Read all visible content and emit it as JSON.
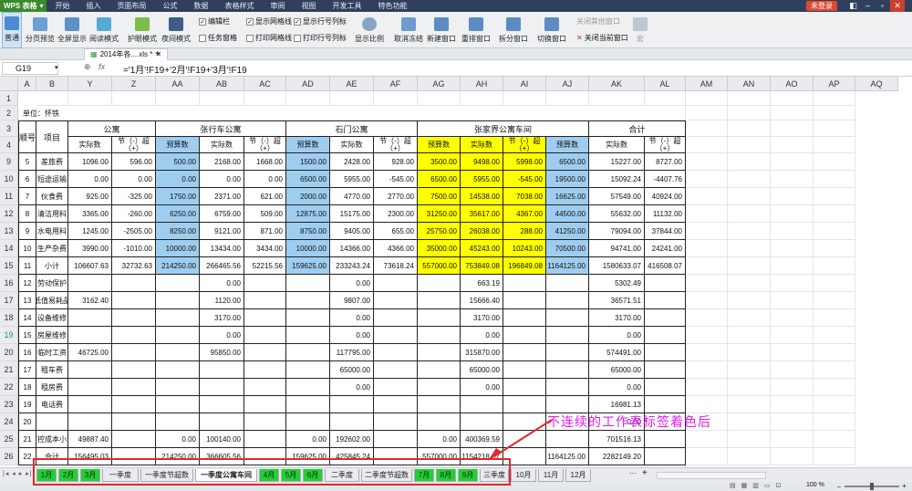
{
  "app": {
    "name": "WPS 表格",
    "login": "未登录"
  },
  "menu": [
    "开始",
    "插入",
    "页面布局",
    "公式",
    "数据",
    "表格样式",
    "审阅",
    "视图",
    "开发工具",
    "特色功能"
  ],
  "toolbar": {
    "normal": "普通",
    "page_break": "分页预览",
    "fullscreen": "全屏显示",
    "reading": "阅读模式",
    "eye_care": "护眼模式",
    "night": "夜间模式",
    "edit_bar": "编辑栏",
    "task_pane": "任务窗格",
    "show_grid": "显示网格线",
    "print_grid": "打印网格线",
    "show_headers": "显示行号列标",
    "print_headers": "打印行号列标",
    "zoom": "显示比例",
    "unfreeze": "取消冻结",
    "new_window": "新建窗口",
    "arrange": "重排窗口",
    "split": "拆分窗口",
    "switch": "切换窗口",
    "close_others": "关闭其他窗口",
    "close_current": "关闭当前窗口",
    "macro": "宏"
  },
  "doc_tab": "2014年各....xls *",
  "formula": {
    "cell_ref": "G19",
    "fx": "fx",
    "content": "='1月'!F19+'2月'!F19+'3月'!F19"
  },
  "col_letters": [
    "A",
    "B",
    "Y",
    "Z",
    "AA",
    "AB",
    "AC",
    "AD",
    "AE",
    "AF",
    "AG",
    "AH",
    "AI",
    "AJ",
    "AK",
    "AL",
    "AM",
    "AN",
    "AO",
    "AP",
    "AQ"
  ],
  "row_numbers": [
    "1",
    "2",
    "3",
    "4",
    "9",
    "10",
    "11",
    "12",
    "13",
    "14",
    "15",
    "16",
    "17",
    "18",
    "19",
    "20",
    "21",
    "22",
    "23",
    "24",
    "25",
    "26"
  ],
  "header": {
    "unit": "单位：怀铁",
    "seq": "顺号",
    "item": "项目",
    "groups": [
      "公寓",
      "张行车公寓",
      "石门公寓",
      "张家界公寓车间",
      "合计"
    ],
    "actual": "实际数",
    "budget": "预算数",
    "diff": "节（-）超（+）"
  },
  "rows": [
    {
      "n": "5",
      "name": "差旅费",
      "y": "1096.00",
      "z": "596.00",
      "aa": "500.00",
      "ab": "2168.00",
      "ac": "1668.00",
      "ad": "1500.00",
      "ae": "2428.00",
      "af": "928.00",
      "ag": "3500.00",
      "ah": "9498.00",
      "ai": "5998.00",
      "aj": "6500.00",
      "ak": "15227.00",
      "al": "8727.00"
    },
    {
      "n": "6",
      "name": "短途运输",
      "y": "0.00",
      "z": "0.00",
      "aa": "0.00",
      "ab": "0.00",
      "ac": "0.00",
      "ad": "6500.00",
      "ae": "5955.00",
      "af": "-545.00",
      "ag": "6500.00",
      "ah": "5955.00",
      "ai": "-545.00",
      "aj": "19500.00",
      "ak": "15092.24",
      "al": "-4407.76"
    },
    {
      "n": "7",
      "name": "伙食费",
      "y": "925.00",
      "z": "-325.00",
      "aa": "1750.00",
      "ab": "2371.00",
      "ac": "621.00",
      "ad": "2000.00",
      "ae": "4770.00",
      "af": "2770.00",
      "ag": "7500.00",
      "ah": "14538.00",
      "ai": "7038.00",
      "aj": "16625.00",
      "ak": "57549.00",
      "al": "40924.00"
    },
    {
      "n": "8",
      "name": "清洁用料",
      "y": "3365.00",
      "z": "-260.00",
      "aa": "6250.00",
      "ab": "6759.00",
      "ac": "509.00",
      "ad": "12875.00",
      "ae": "15175.00",
      "af": "2300.00",
      "ag": "31250.00",
      "ah": "35617.00",
      "ai": "4367.00",
      "aj": "44500.00",
      "ak": "55632.00",
      "al": "11132.00"
    },
    {
      "n": "9",
      "name": "水电用料",
      "y": "1245.00",
      "z": "-2505.00",
      "aa": "8250.00",
      "ab": "9121.00",
      "ac": "871.00",
      "ad": "8750.00",
      "ae": "9405.00",
      "af": "655.00",
      "ag": "25750.00",
      "ah": "26038.00",
      "ai": "288.00",
      "aj": "41250.00",
      "ak": "79094.00",
      "al": "37844.00"
    },
    {
      "n": "10",
      "name": "生产杂费",
      "y": "3990.00",
      "z": "-1010.00",
      "aa": "10000.00",
      "ab": "13434.00",
      "ac": "3434.00",
      "ad": "10000.00",
      "ae": "14366.00",
      "af": "4366.00",
      "ag": "35000.00",
      "ah": "45243.00",
      "ai": "10243.00",
      "aj": "70500.00",
      "ak": "94741.00",
      "al": "24241.00"
    },
    {
      "n": "11",
      "name": "小计",
      "y": "106607.63",
      "z": "32732.63",
      "aa": "214250.00",
      "ab": "266465.56",
      "ac": "52215.56",
      "ad": "159625.00",
      "ae": "233243.24",
      "af": "73618.24",
      "ag": "557000.00",
      "ah": "753849.08",
      "ai": "196849.08",
      "aj": "1164125.00",
      "ak": "1580633.07",
      "al": "416508.07"
    },
    {
      "n": "12",
      "name": "劳动保护",
      "y": "",
      "z": "",
      "aa": "",
      "ab": "0.00",
      "ac": "",
      "ad": "",
      "ae": "0.00",
      "af": "",
      "ag": "",
      "ah": "663.19",
      "ai": "",
      "aj": "",
      "ak": "5302.49",
      "al": ""
    },
    {
      "n": "13",
      "name": "低值易耗品",
      "y": "3162.40",
      "z": "",
      "aa": "",
      "ab": "1120.00",
      "ac": "",
      "ad": "",
      "ae": "9807.00",
      "af": "",
      "ag": "",
      "ah": "15666.40",
      "ai": "",
      "aj": "",
      "ak": "36571.51",
      "al": ""
    },
    {
      "n": "14",
      "name": "设备维修",
      "y": "",
      "z": "",
      "aa": "",
      "ab": "3170.00",
      "ac": "",
      "ad": "",
      "ae": "0.00",
      "af": "",
      "ag": "",
      "ah": "3170.00",
      "ai": "",
      "aj": "",
      "ak": "3170.00",
      "al": ""
    },
    {
      "n": "15",
      "name": "房屋维修",
      "y": "",
      "z": "",
      "aa": "",
      "ab": "0.00",
      "ac": "",
      "ad": "",
      "ae": "0.00",
      "af": "",
      "ag": "",
      "ah": "0.00",
      "ai": "",
      "aj": "",
      "ak": "0.00",
      "al": ""
    },
    {
      "n": "16",
      "name": "临时工资",
      "y": "46725.00",
      "z": "",
      "aa": "",
      "ab": "95850.00",
      "ac": "",
      "ad": "",
      "ae": "117795.00",
      "af": "",
      "ag": "",
      "ah": "315870.00",
      "ai": "",
      "aj": "",
      "ak": "574491.00",
      "al": ""
    },
    {
      "n": "17",
      "name": "租车费",
      "y": "",
      "z": "",
      "aa": "",
      "ab": "",
      "ac": "",
      "ad": "",
      "ae": "65000.00",
      "af": "",
      "ag": "",
      "ah": "65000.00",
      "ai": "",
      "aj": "",
      "ak": "65000.00",
      "al": ""
    },
    {
      "n": "18",
      "name": "租房费",
      "y": "",
      "z": "",
      "aa": "",
      "ab": "",
      "ac": "",
      "ad": "",
      "ae": "0.00",
      "af": "",
      "ag": "",
      "ah": "0.00",
      "ai": "",
      "aj": "",
      "ak": "0.00",
      "al": ""
    },
    {
      "n": "19",
      "name": "电话费",
      "y": "",
      "z": "",
      "aa": "",
      "ab": "",
      "ac": "",
      "ad": "",
      "ae": "",
      "af": "",
      "ag": "",
      "ah": "",
      "ai": "",
      "aj": "",
      "ak": "16981.13",
      "al": ""
    },
    {
      "n": "20",
      "name": "",
      "y": "",
      "z": "",
      "aa": "",
      "ab": "",
      "ac": "",
      "ad": "",
      "ae": "",
      "af": "",
      "ag": "",
      "ah": "",
      "ai": "",
      "aj": "",
      "ak": "0.00",
      "al": ""
    },
    {
      "n": "21",
      "name": "可控成本小计",
      "y": "49887.40",
      "z": "",
      "aa": "0.00",
      "ab": "100140.00",
      "ac": "",
      "ad": "0.00",
      "ae": "192602.00",
      "af": "",
      "ag": "0.00",
      "ah": "400369.59",
      "ai": "",
      "aj": "",
      "ak": "701516.13",
      "al": ""
    },
    {
      "n": "22",
      "name": "合计",
      "y": "156495.03",
      "z": "",
      "aa": "214250.00",
      "ab": "366605.56",
      "ac": "",
      "ad": "159625.00",
      "ae": "425845.24",
      "af": "",
      "ag": "557000.00",
      "ah": "1154218.67",
      "ai": "",
      "aj": "1164125.00",
      "ak": "2282149.20",
      "al": ""
    }
  ],
  "sheets": [
    {
      "label": "1月",
      "green": true
    },
    {
      "label": "2月",
      "green": true
    },
    {
      "label": "3月",
      "green": true
    },
    {
      "label": "一季度",
      "green": false
    },
    {
      "label": "一季度节超数",
      "green": false
    },
    {
      "label": "一季度公寓车间",
      "green": false,
      "active": true
    },
    {
      "label": "4月",
      "green": true
    },
    {
      "label": "5月",
      "green": true
    },
    {
      "label": "6月",
      "green": true
    },
    {
      "label": "二季度",
      "green": false
    },
    {
      "label": "二季度节超数",
      "green": false
    },
    {
      "label": "7月",
      "green": true
    },
    {
      "label": "8月",
      "green": true
    },
    {
      "label": "9月",
      "green": true
    },
    {
      "label": "三季度",
      "green": false
    },
    {
      "label": "10月",
      "green": false
    },
    {
      "label": "11月",
      "green": false
    },
    {
      "label": "12月",
      "green": false
    }
  ],
  "status": {
    "zoom": "100 %"
  },
  "annotation": "不连续的工作表标签着色后",
  "colors": {
    "blue": "#9fcdf0",
    "yellow": "#ffff00",
    "green": "#23cf33",
    "annot": "#e51af1"
  }
}
